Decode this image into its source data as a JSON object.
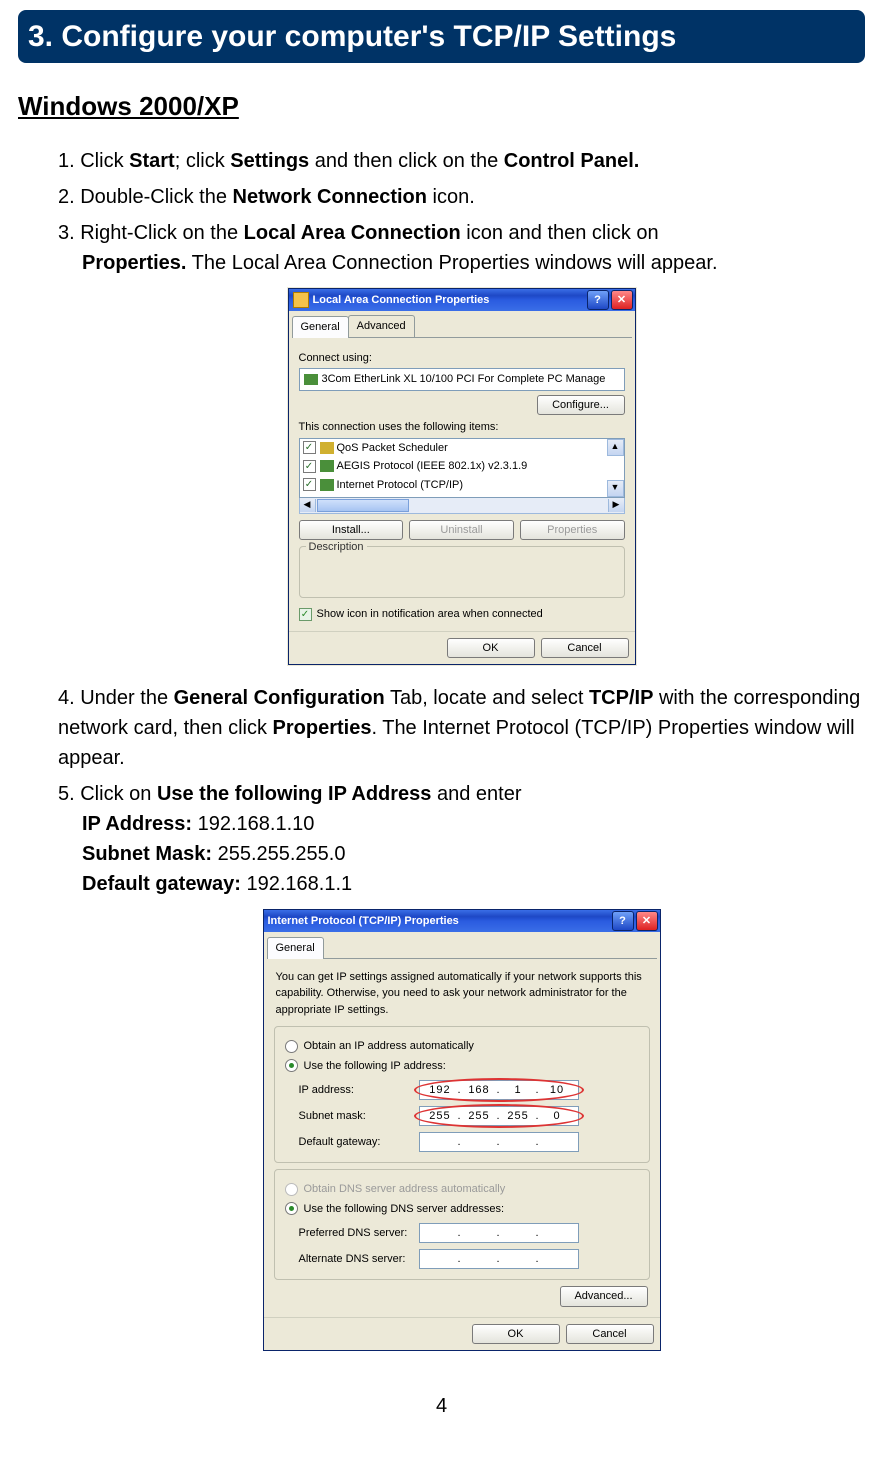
{
  "section_title": "3. Configure your computer's TCP/IP Settings",
  "subheading": "Windows 2000/XP",
  "steps": {
    "s1_a": "1. Click ",
    "s1_b": "Start",
    "s1_c": "; click ",
    "s1_d": "Settings",
    "s1_e": " and then click on the ",
    "s1_f": "Control Panel.",
    "s2_a": "2. Double-Click the ",
    "s2_b": "Network Connection",
    "s2_c": " icon.",
    "s3_a": "3. Right-Click on the ",
    "s3_b": "Local Area Connection",
    "s3_c": " icon and then click on ",
    "s3_d": "Properties.",
    "s3_e": " The Local Area Connection Properties windows will appear.",
    "s4_a": "4. Under the ",
    "s4_b": "General Configuration",
    "s4_c": " Tab, locate and select ",
    "s4_d": "TCP/IP",
    "s4_e": " with the corresponding network card, then click ",
    "s4_f": "Properties",
    "s4_g": ". The Internet Protocol (TCP/IP) Properties window will appear.",
    "s5_a": "5. Click on ",
    "s5_b": "Use the following IP Address",
    "s5_c": " and enter",
    "ip_lbl": "IP Address: ",
    "ip_val": "192.168.1.10",
    "mask_lbl": "Subnet Mask: ",
    "mask_val": "255.255.255.0",
    "gw_lbl": "Default gateway: ",
    "gw_val": "192.168.1.1"
  },
  "dialog1": {
    "title": "Local Area Connection Properties",
    "help": "?",
    "close": "✕",
    "tab_general": "General",
    "tab_advanced": "Advanced",
    "connect_using": "Connect using:",
    "adapter": "3Com EtherLink XL 10/100 PCI For Complete PC Manage",
    "configure": "Configure...",
    "uses_items": "This connection uses the following items:",
    "item1": "QoS Packet Scheduler",
    "item2": "AEGIS Protocol (IEEE 802.1x) v2.3.1.9",
    "item3": "Internet Protocol (TCP/IP)",
    "install": "Install...",
    "uninstall": "Uninstall",
    "properties": "Properties",
    "description": "Description",
    "showicon": "Show icon in notification area when connected",
    "ok": "OK",
    "cancel": "Cancel"
  },
  "dialog2": {
    "title": "Internet Protocol (TCP/IP) Properties",
    "help": "?",
    "close": "✕",
    "tab_general": "General",
    "desc": "You can get IP settings assigned automatically if your network supports this capability. Otherwise, you need to ask your network administrator for the appropriate IP settings.",
    "radio_auto_ip": "Obtain an IP address automatically",
    "radio_use_ip": "Use the following IP address:",
    "lbl_ip": "IP address:",
    "lbl_mask": "Subnet mask:",
    "lbl_gw": "Default gateway:",
    "ip": [
      "192",
      "168",
      "1",
      "10"
    ],
    "mask": [
      "255",
      "255",
      "255",
      "0"
    ],
    "gw": [
      "",
      "",
      "",
      ""
    ],
    "radio_auto_dns": "Obtain DNS server address automatically",
    "radio_use_dns": "Use the following DNS server addresses:",
    "lbl_pref": "Preferred DNS server:",
    "lbl_alt": "Alternate DNS server:",
    "pref": [
      "",
      "",
      "",
      ""
    ],
    "alt": [
      "",
      "",
      "",
      ""
    ],
    "advanced": "Advanced...",
    "ok": "OK",
    "cancel": "Cancel"
  },
  "page_number": "4"
}
